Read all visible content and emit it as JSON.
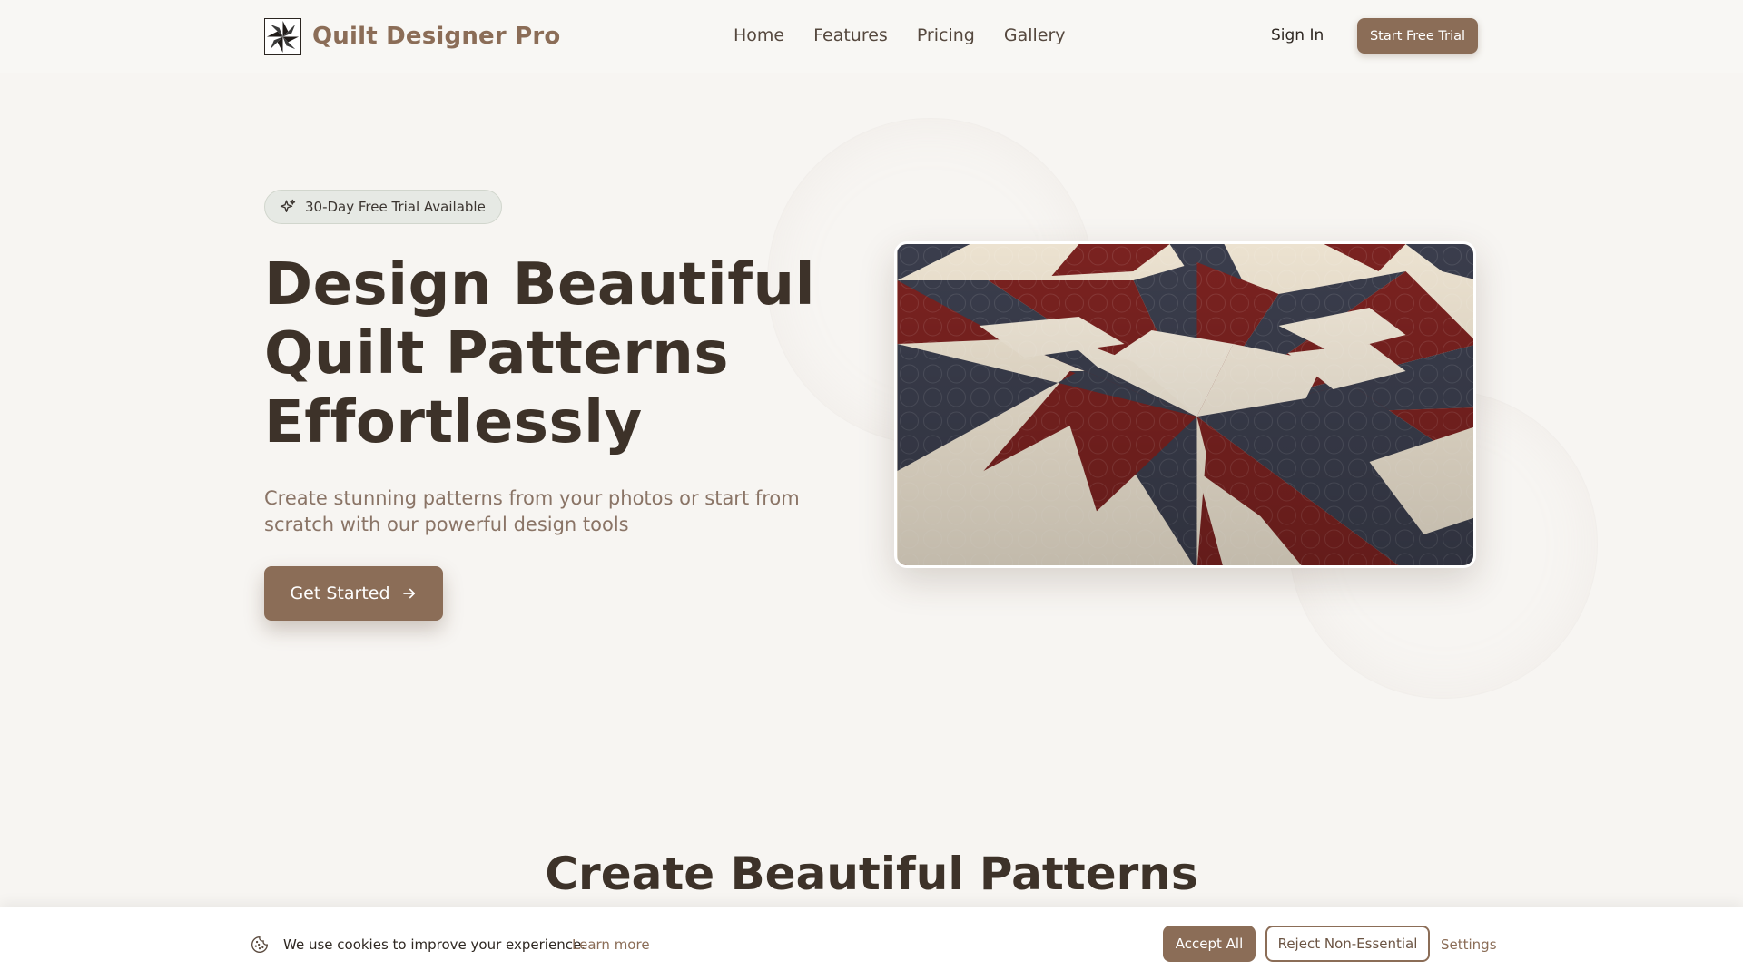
{
  "brand": {
    "name": "Quilt Designer Pro",
    "accent_color": "#8b6d57",
    "logo_icon": "quilt-star-icon"
  },
  "nav": {
    "links": [
      "Home",
      "Features",
      "Pricing",
      "Gallery"
    ],
    "sign_in": "Sign In",
    "trial_button": "Start Free Trial"
  },
  "hero": {
    "badge": "30-Day Free Trial Available",
    "badge_icon": "sparkle-icon",
    "title_lines": [
      "Design Beautiful",
      "Quilt Patterns",
      "Effortlessly"
    ],
    "subtitle": "Create stunning patterns from your photos or start from scratch with our powerful design tools",
    "cta": "Get Started",
    "cta_icon": "arrow-right-icon",
    "image_subject": "star-quilt-photo"
  },
  "section": {
    "title": "Create Beautiful Patterns"
  },
  "cookie": {
    "icon": "cookie-icon",
    "message": "We use cookies to improve your experience.",
    "learn_more": "Learn more",
    "accept": "Accept All",
    "reject": "Reject Non-Essential",
    "settings": "Settings"
  },
  "colors": {
    "page_bg": "#f7f5f2",
    "heading": "#3d3229",
    "subtitle": "#8a7466",
    "quilt_red": "#7a2220",
    "quilt_navy": "#3a3d4c",
    "quilt_cream": "#efe6d6"
  }
}
